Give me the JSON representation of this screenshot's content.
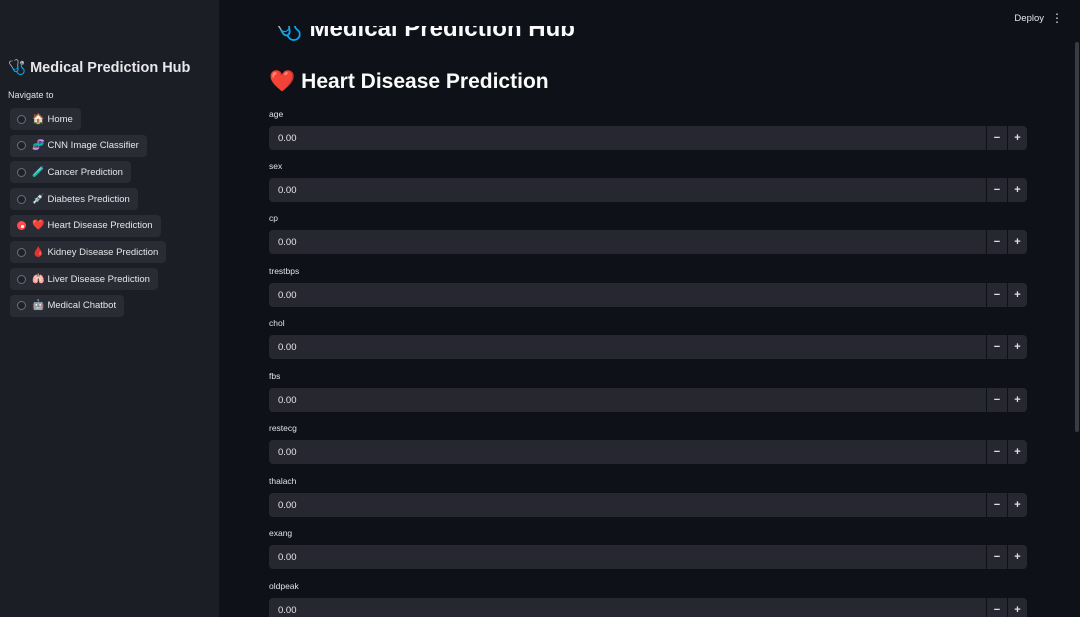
{
  "sidebar": {
    "app_title": "Medical Prediction Hub",
    "app_icon": "🩺",
    "nav_label": "Navigate to",
    "items": [
      {
        "emoji": "🏠",
        "label": "Home",
        "selected": false
      },
      {
        "emoji": "🧬",
        "label": "CNN Image Classifier",
        "selected": false
      },
      {
        "emoji": "🧪",
        "label": "Cancer Prediction",
        "selected": false
      },
      {
        "emoji": "💉",
        "label": "Diabetes Prediction",
        "selected": false
      },
      {
        "emoji": "❤️",
        "label": "Heart Disease Prediction",
        "selected": true
      },
      {
        "emoji": "🩸",
        "label": "Kidney Disease Prediction",
        "selected": false
      },
      {
        "emoji": "🫁",
        "label": "Liver Disease Prediction",
        "selected": false
      },
      {
        "emoji": "🤖",
        "label": "Medical Chatbot",
        "selected": false
      }
    ]
  },
  "header": {
    "deploy_label": "Deploy",
    "menu_icon": "⋮"
  },
  "main": {
    "hub_title": "🩺 Medical Prediction Hub",
    "page_title": "Heart Disease Prediction",
    "page_icon": "❤️",
    "fields": [
      {
        "label": "age",
        "value": "0.00"
      },
      {
        "label": "sex",
        "value": "0.00"
      },
      {
        "label": "cp",
        "value": "0.00"
      },
      {
        "label": "trestbps",
        "value": "0.00"
      },
      {
        "label": "chol",
        "value": "0.00"
      },
      {
        "label": "fbs",
        "value": "0.00"
      },
      {
        "label": "restecg",
        "value": "0.00"
      },
      {
        "label": "thalach",
        "value": "0.00"
      },
      {
        "label": "exang",
        "value": "0.00"
      },
      {
        "label": "oldpeak",
        "value": "0.00"
      }
    ],
    "minus_label": "−",
    "plus_label": "+"
  },
  "colors": {
    "background": "#0e1117",
    "sidebar": "#1c1e25",
    "input": "#262730",
    "accent": "#ff4b4b"
  }
}
